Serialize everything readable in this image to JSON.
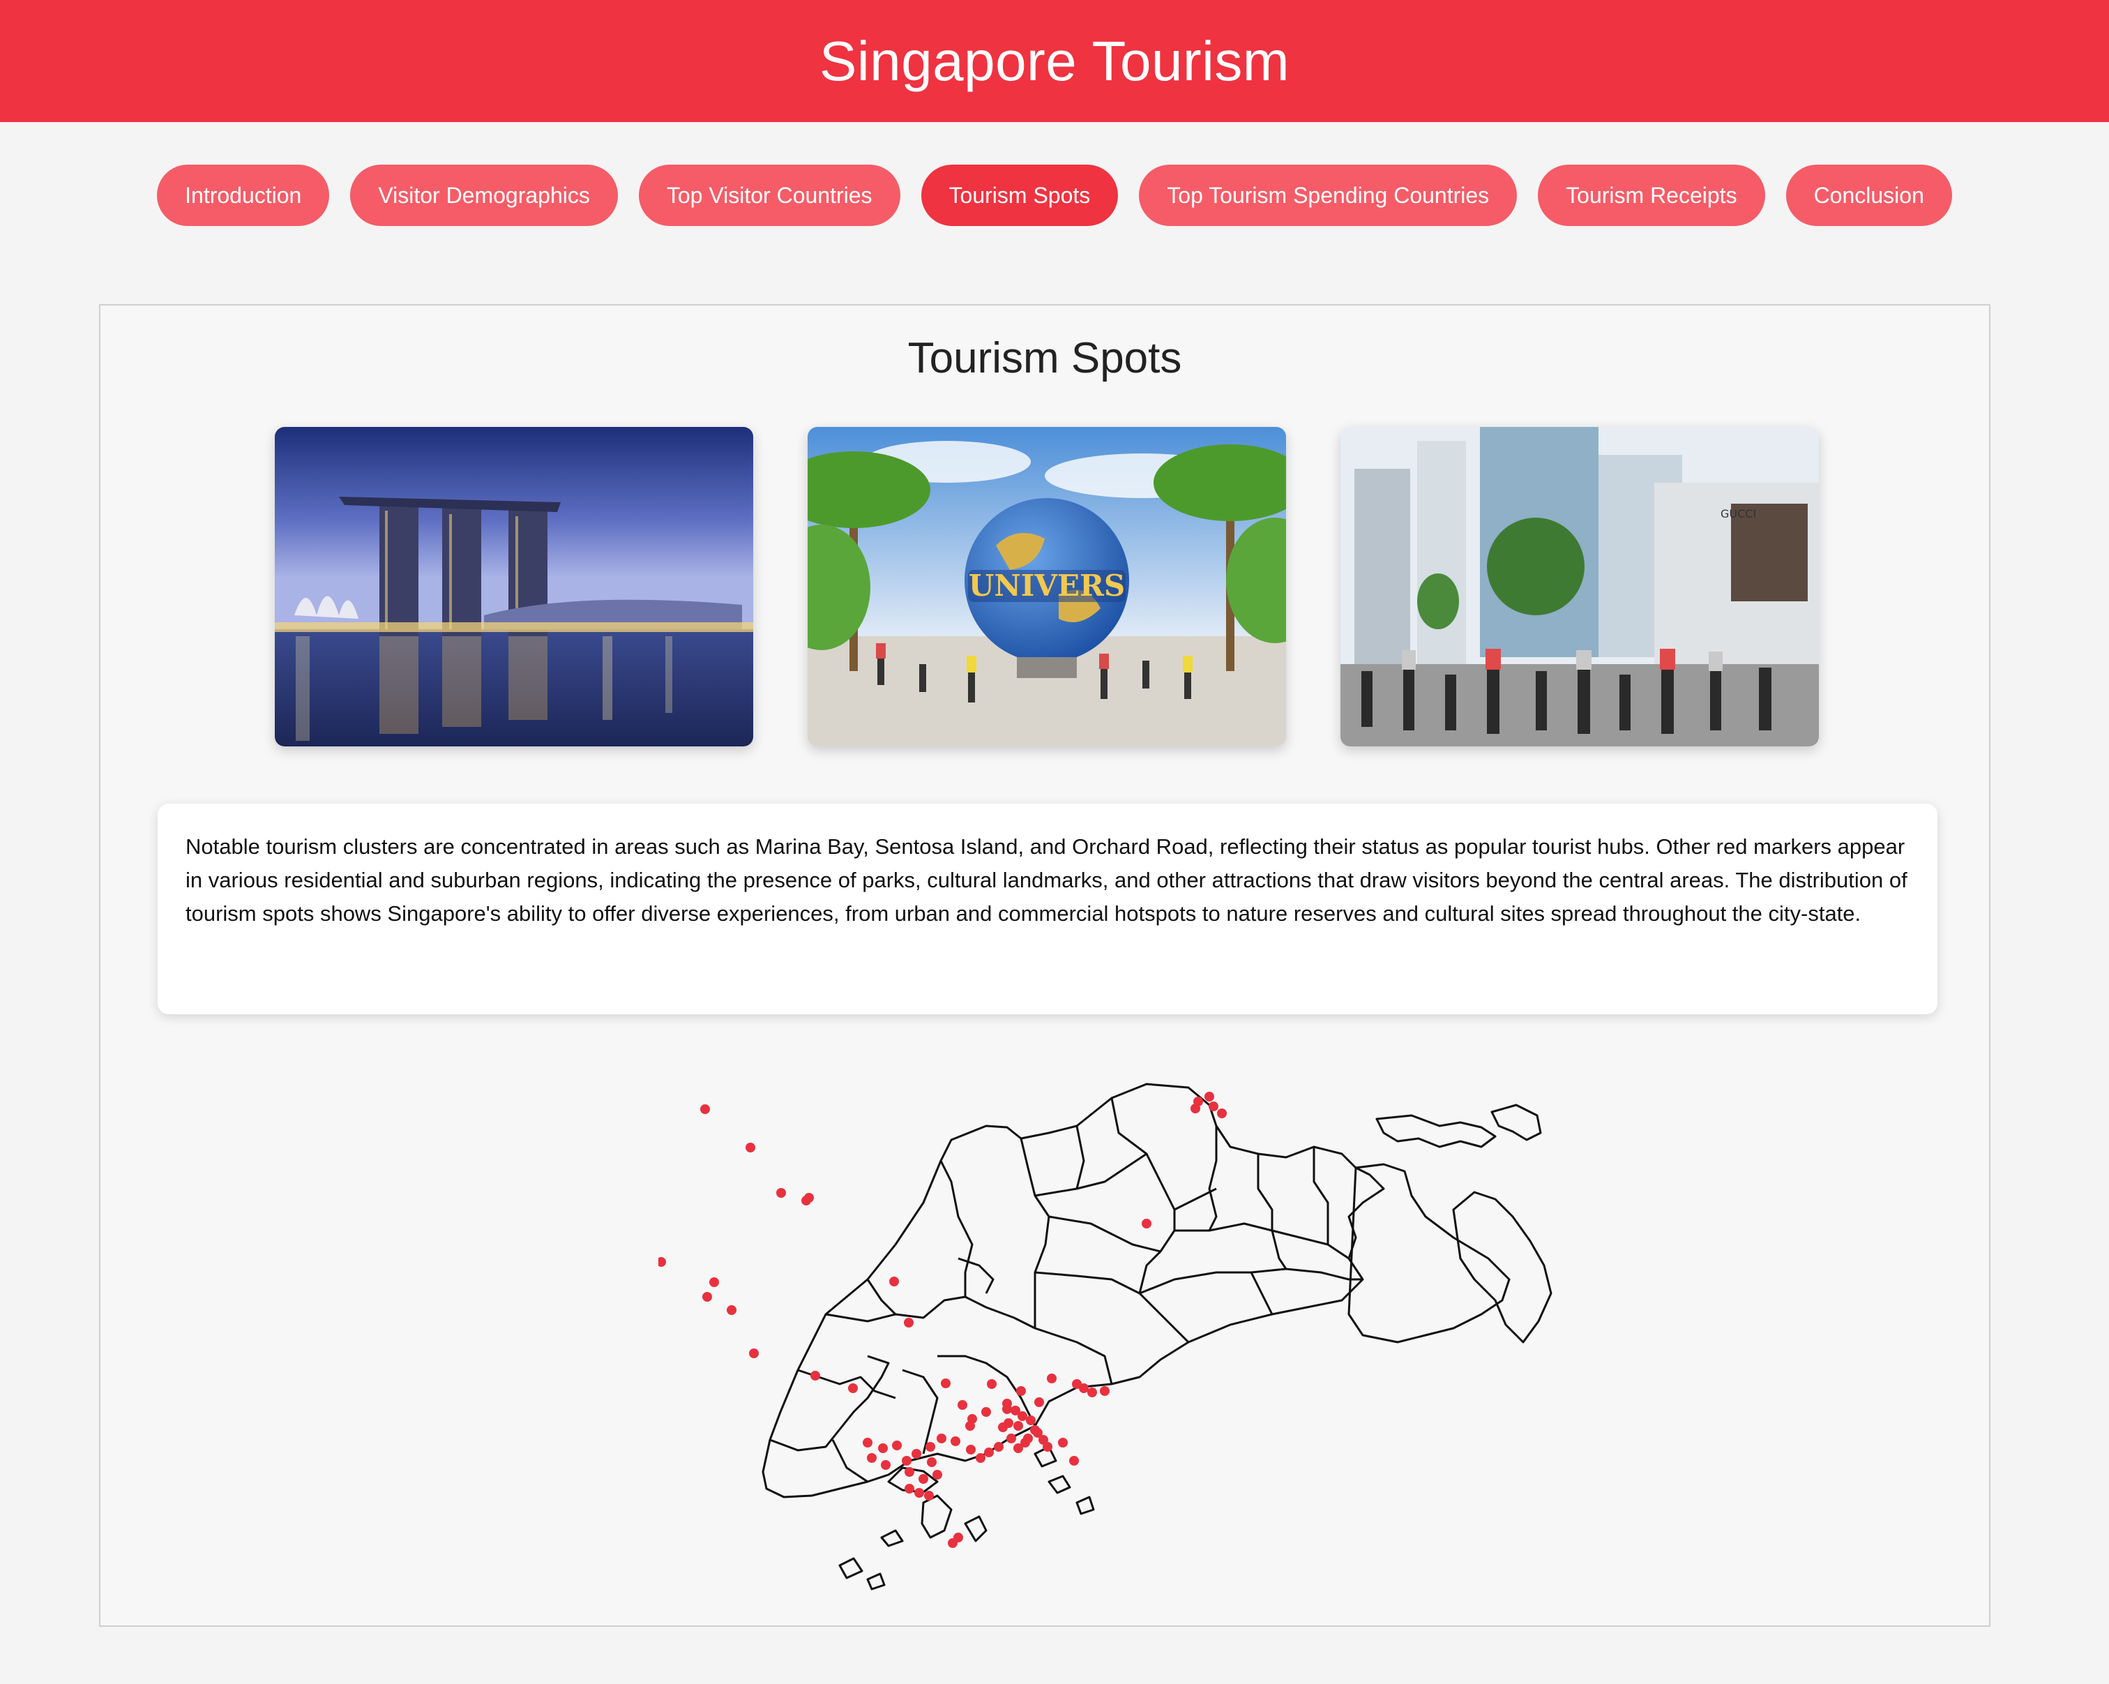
{
  "header": {
    "title": "Singapore Tourism"
  },
  "nav": {
    "items": [
      {
        "label": "Introduction",
        "active": false
      },
      {
        "label": "Visitor Demographics",
        "active": false
      },
      {
        "label": "Top Visitor Countries",
        "active": false
      },
      {
        "label": "Tourism Spots",
        "active": true
      },
      {
        "label": "Top Tourism Spending Countries",
        "active": false
      },
      {
        "label": "Tourism Receipts",
        "active": false
      },
      {
        "label": "Conclusion",
        "active": false
      }
    ]
  },
  "section": {
    "title": "Tourism Spots",
    "photos": [
      {
        "subject": "marina-bay-sands-night"
      },
      {
        "subject": "universal-studios-globe",
        "sign_text": "UNIVERS"
      },
      {
        "subject": "orchard-road-street",
        "store_sign": "GUCCI"
      }
    ],
    "description": "Notable tourism clusters are concentrated in areas such as Marina Bay, Sentosa Island, and Orchard Road, reflecting their status as popular tourist hubs. Other red markers appear in various residential and suburban regions, indicating the presence of parks, cultural landmarks, and other attractions that draw visitors beyond the central areas. The distribution of tourism spots shows Singapore's ability to offer diverse experiences, from urban and commercial hotspots to nature reserves and cultural sites spread throughout the city-state."
  },
  "map": {
    "marker_color": "#e8313f",
    "outline_color": "#111111"
  },
  "colors": {
    "brand_red": "#ef3340",
    "button_red": "#f55c67",
    "page_bg": "#f4f4f4"
  }
}
